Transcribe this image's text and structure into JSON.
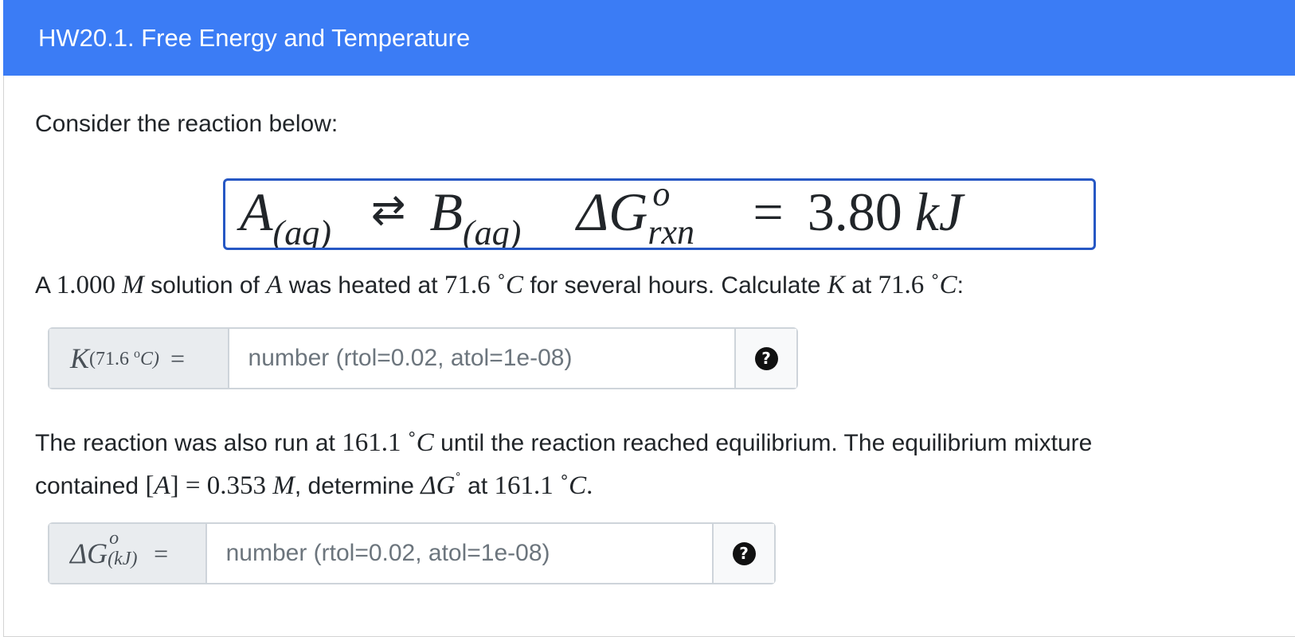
{
  "header": {
    "title": "HW20.1. Free Energy and Temperature"
  },
  "intro": {
    "text": "Consider the reaction below:"
  },
  "equation": {
    "reactant": "A",
    "reactant_state": "(aq)",
    "arrow": "⇄",
    "product": "B",
    "product_state": "(aq)",
    "delta_g": "ΔG",
    "delta_g_sup": "o",
    "delta_g_sub": "rxn",
    "equals": "=",
    "value": "3.80",
    "unit": "kJ"
  },
  "question1": {
    "p1": "A ",
    "conc": "1.000",
    "conc_unit": "M",
    "p2": " solution of ",
    "species": "A",
    "p3": " was heated at ",
    "temp": "71.6",
    "deg": "˚",
    "temp_unit": "C",
    "p4": " for several hours. Calculate ",
    "k": "K",
    "p5": " at ",
    "temp2": "71.6",
    "deg2": "˚",
    "temp_unit2": "C",
    "p6": ":"
  },
  "input1": {
    "label_main": "K",
    "label_sub": "(71.6 ",
    "label_sub_deg": "o",
    "label_sub_c": "C)",
    "label_eq": "=",
    "placeholder": "number (rtol=0.02, atol=1e-08)",
    "help_icon": "question-circle-icon",
    "help_glyph": "?"
  },
  "question2": {
    "line1_a": "The reaction was also run at ",
    "temp": "161.1",
    "deg": "˚",
    "temp_unit": "C",
    "line1_b": " until the reaction reached equilibrium. The equilibrium mixture",
    "line2_a": "contained ",
    "conc_expr_l": "[",
    "conc_species": "A",
    "conc_expr_r": "]",
    "equals": " = ",
    "conc_value": "0.353",
    "conc_unit": "M",
    "line2_b": ", determine ",
    "dg": "ΔG",
    "dg_deg": "˚",
    "line2_c": " at ",
    "temp2": "161.1",
    "deg2": "˚",
    "temp_unit2": "C",
    "period": "."
  },
  "input2": {
    "label_main": "ΔG",
    "label_sup": "o",
    "label_sub": "(kJ)",
    "label_eq": "=",
    "placeholder": "number (rtol=0.02, atol=1e-08)",
    "help_icon": "question-circle-icon",
    "help_glyph": "?"
  },
  "colors": {
    "header_bg": "#3b7cf5",
    "equation_border": "#2657c4"
  }
}
